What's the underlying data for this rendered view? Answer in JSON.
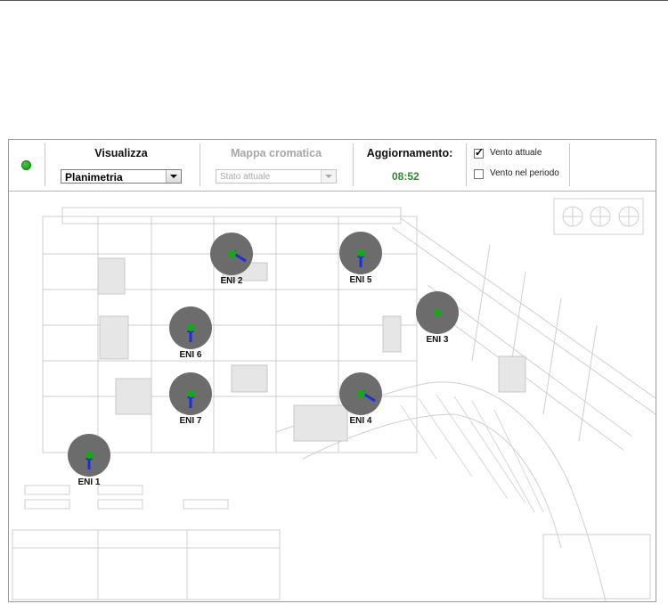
{
  "toolbar": {
    "status_color": "#1a9a1a",
    "visualizza": {
      "title": "Visualizza",
      "selected": "Planimetria"
    },
    "mappa": {
      "title": "Mappa cromatica",
      "selected": "Stato attuale",
      "disabled": true
    },
    "aggiornamento": {
      "title": "Aggiornamento:",
      "time": "08:52"
    },
    "options": [
      {
        "label": "Vento attuale",
        "checked": true
      },
      {
        "label": "Vento nel periodo",
        "checked": false
      }
    ]
  },
  "stations": [
    {
      "name": "ENI 2",
      "wind_direction": "north-west"
    },
    {
      "name": "ENI 5",
      "wind_direction": "south"
    },
    {
      "name": "ENI 3",
      "wind_direction": "none"
    },
    {
      "name": "ENI 6",
      "wind_direction": "south"
    },
    {
      "name": "ENI 7",
      "wind_direction": "south"
    },
    {
      "name": "ENI 4",
      "wind_direction": "north-west"
    },
    {
      "name": "ENI 1",
      "wind_direction": "south"
    }
  ],
  "colors": {
    "station_circle": "#666666",
    "station_dot": "#1aa51a",
    "wind_arrow": "#1a2ee0",
    "time_text": "#2d8a2d"
  }
}
